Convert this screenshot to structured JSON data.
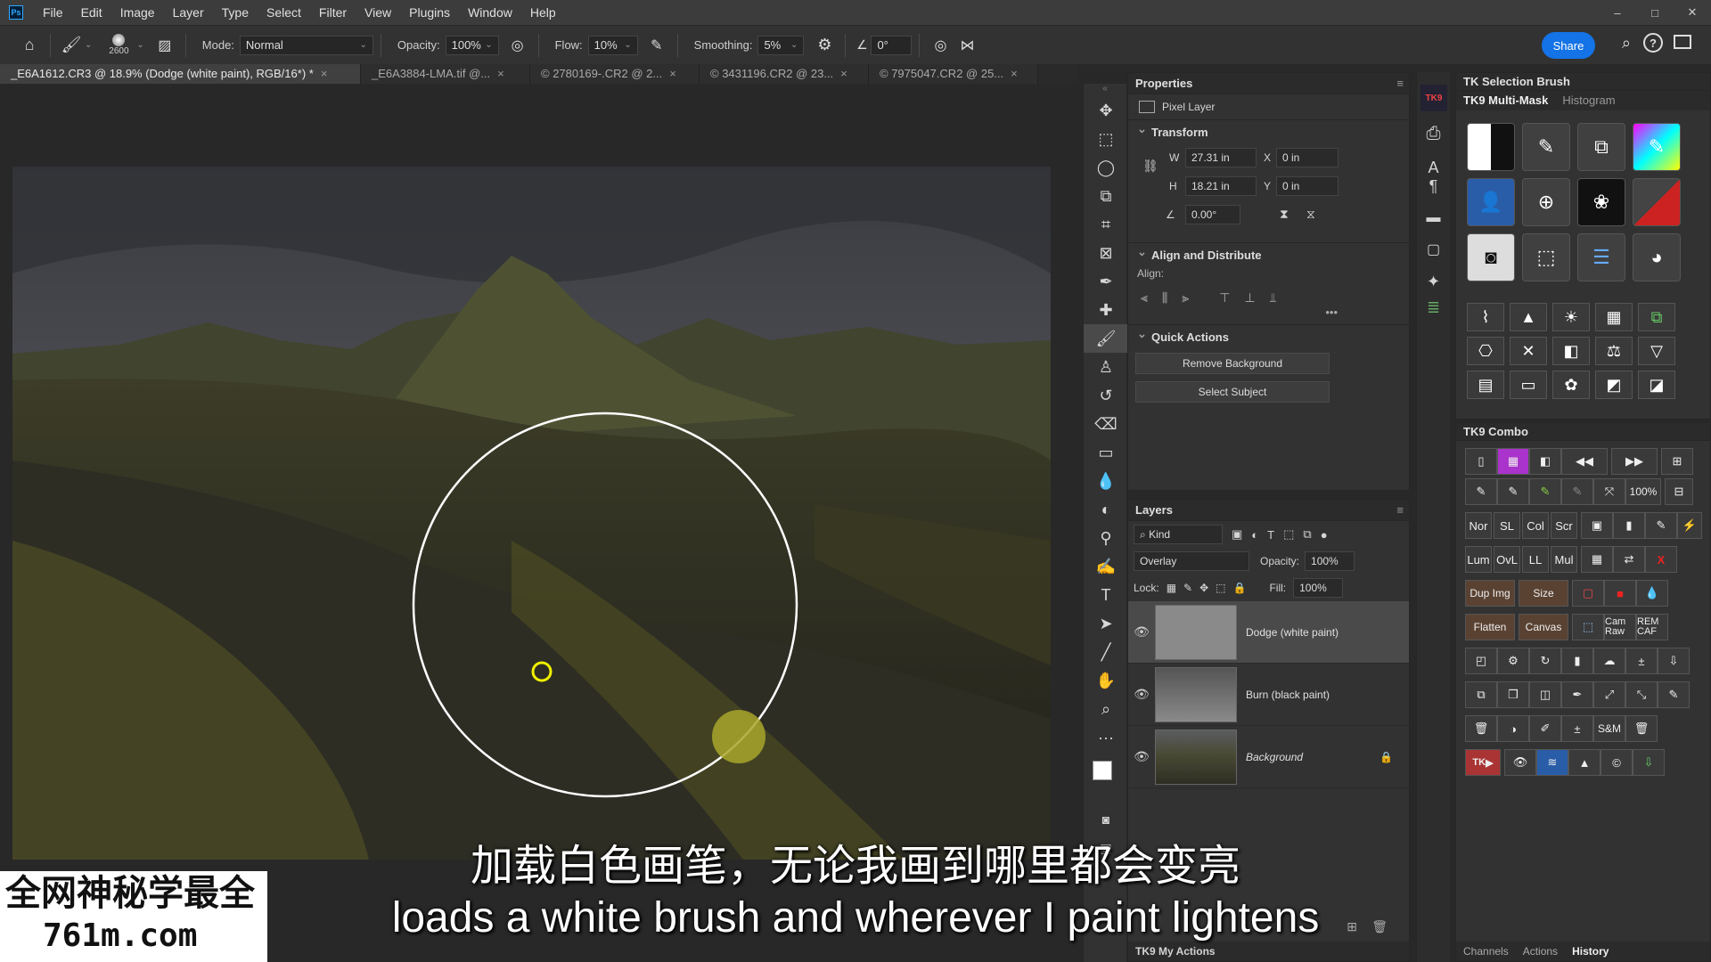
{
  "menubar": {
    "items": [
      "File",
      "Edit",
      "Image",
      "Layer",
      "Type",
      "Select",
      "Filter",
      "View",
      "Plugins",
      "Window",
      "Help"
    ],
    "window_controls": [
      "–",
      "□",
      "✕"
    ]
  },
  "options": {
    "brush_size": "2600",
    "mode_label": "Mode:",
    "mode_value": "Normal",
    "opacity_label": "Opacity:",
    "opacity_value": "100%",
    "flow_label": "Flow:",
    "flow_value": "10%",
    "smoothing_label": "Smoothing:",
    "smoothing_value": "5%",
    "angle_value": "0°",
    "share_label": "Share"
  },
  "tabs": [
    {
      "label": "_E6A1612.CR3 @ 18.9% (Dodge (white paint), RGB/16*) *",
      "close": "×"
    },
    {
      "label": "_E6A3884-LMA.tif @...",
      "close": "×"
    },
    {
      "label": "© 2780169-.CR2 @ 2...",
      "close": "×"
    },
    {
      "label": "© 3431196.CR2 @ 23...",
      "close": "×"
    },
    {
      "label": "© 7975047.CR2 @ 25...",
      "close": "×"
    }
  ],
  "properties": {
    "title": "Properties",
    "layer_type": "Pixel Layer",
    "transform_title": "Transform",
    "w_label": "W",
    "w_value": "27.31 in",
    "h_label": "H",
    "h_value": "18.21 in",
    "x_label": "X",
    "x_value": "0 in",
    "y_label": "Y",
    "y_value": "0 in",
    "angle_value": "0.00°",
    "align_title": "Align and Distribute",
    "align_label": "Align:",
    "more": "•••",
    "quick_title": "Quick Actions",
    "remove_bg": "Remove Background",
    "select_subject": "Select Subject"
  },
  "layers": {
    "title": "Layers",
    "filter_kind": "Kind",
    "blend_mode": "Overlay",
    "opacity_label": "Opacity:",
    "opacity_value": "100%",
    "lock_label": "Lock:",
    "fill_label": "Fill:",
    "fill_value": "100%",
    "items": [
      {
        "name": "Dodge (white paint)"
      },
      {
        "name": "Burn (black paint)"
      },
      {
        "name": "Background"
      }
    ],
    "footer_tab": "TK9 My Actions"
  },
  "tk_panel": {
    "title": "TK Selection Brush",
    "tab_active": "TK9 Multi-Mask",
    "tab_other": "Histogram",
    "combo_title": "TK9 Combo",
    "zoom_label": "100%",
    "combo_labels": [
      "Nor",
      "SL",
      "Col",
      "Scr",
      "Lum",
      "OvL",
      "LL",
      "Mul",
      "Dup Img",
      "Size",
      "Flatten",
      "Canvas",
      "Cam Raw",
      "REM CAF",
      "S&M",
      "TK"
    ],
    "bottom_tabs": [
      "Channels",
      "Actions",
      "History"
    ]
  },
  "subtitles": {
    "cn": "加载白色画笔，无论我画到哪里都会变亮",
    "en": "loads a white brush and wherever I paint lightens"
  },
  "watermark": {
    "line1": "全网神秘学最全",
    "line2": "761m.com"
  }
}
